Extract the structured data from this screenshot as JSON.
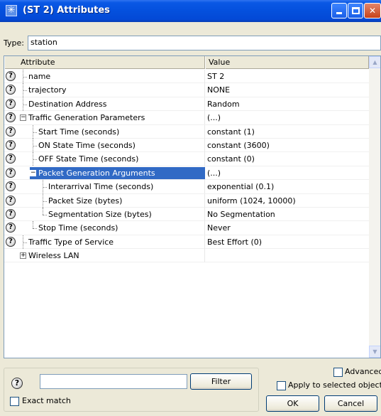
{
  "window": {
    "title": "(ST 2) Attributes",
    "icon": "star-icon",
    "controls": [
      "minimize-icon",
      "maximize-icon",
      "close-icon"
    ]
  },
  "type_field": {
    "label": "Type:",
    "value": "station"
  },
  "table": {
    "columns": [
      "Attribute",
      "Value"
    ],
    "rows": [
      {
        "attribute": "name",
        "value": "ST 2",
        "help": true
      },
      {
        "attribute": "trajectory",
        "value": "NONE",
        "help": true
      },
      {
        "attribute": "Destination Address",
        "value": "Random",
        "help": true
      },
      {
        "attribute": "Traffic Generation Parameters",
        "value": "(...)",
        "help": true
      },
      {
        "attribute": "Start Time (seconds)",
        "value": "constant (1)",
        "help": true
      },
      {
        "attribute": "ON State Time (seconds)",
        "value": "constant (3600)",
        "help": true
      },
      {
        "attribute": "OFF State Time (seconds)",
        "value": "constant (0)",
        "help": true
      },
      {
        "attribute": "Packet Generation Arguments",
        "value": "(...)",
        "help": true
      },
      {
        "attribute": "Interarrival Time (seconds)",
        "value": "exponential (0.1)",
        "help": true
      },
      {
        "attribute": "Packet Size (bytes)",
        "value": "uniform (1024, 10000)",
        "help": true
      },
      {
        "attribute": "Segmentation Size (bytes)",
        "value": "No Segmentation",
        "help": true
      },
      {
        "attribute": "Stop Time (seconds)",
        "value": "Never",
        "help": true
      },
      {
        "attribute": "Traffic Type of Service",
        "value": "Best Effort (0)",
        "help": true
      },
      {
        "attribute": "Wireless LAN",
        "value": "",
        "help": false
      }
    ],
    "selected_row": "Packet Generation Arguments"
  },
  "filter": {
    "value": "",
    "filter_button": "Filter",
    "exact_match_label": "Exact match",
    "exact_match_checked": false
  },
  "options": {
    "advanced_label": "Advanced",
    "advanced_checked": false,
    "apply_label": "Apply to selected objects",
    "apply_checked": false
  },
  "buttons": {
    "ok": "OK",
    "cancel": "Cancel"
  },
  "colors": {
    "titlebar": "#0450dd",
    "selection": "#316ac5",
    "dialog_bg": "#ece9d8"
  }
}
